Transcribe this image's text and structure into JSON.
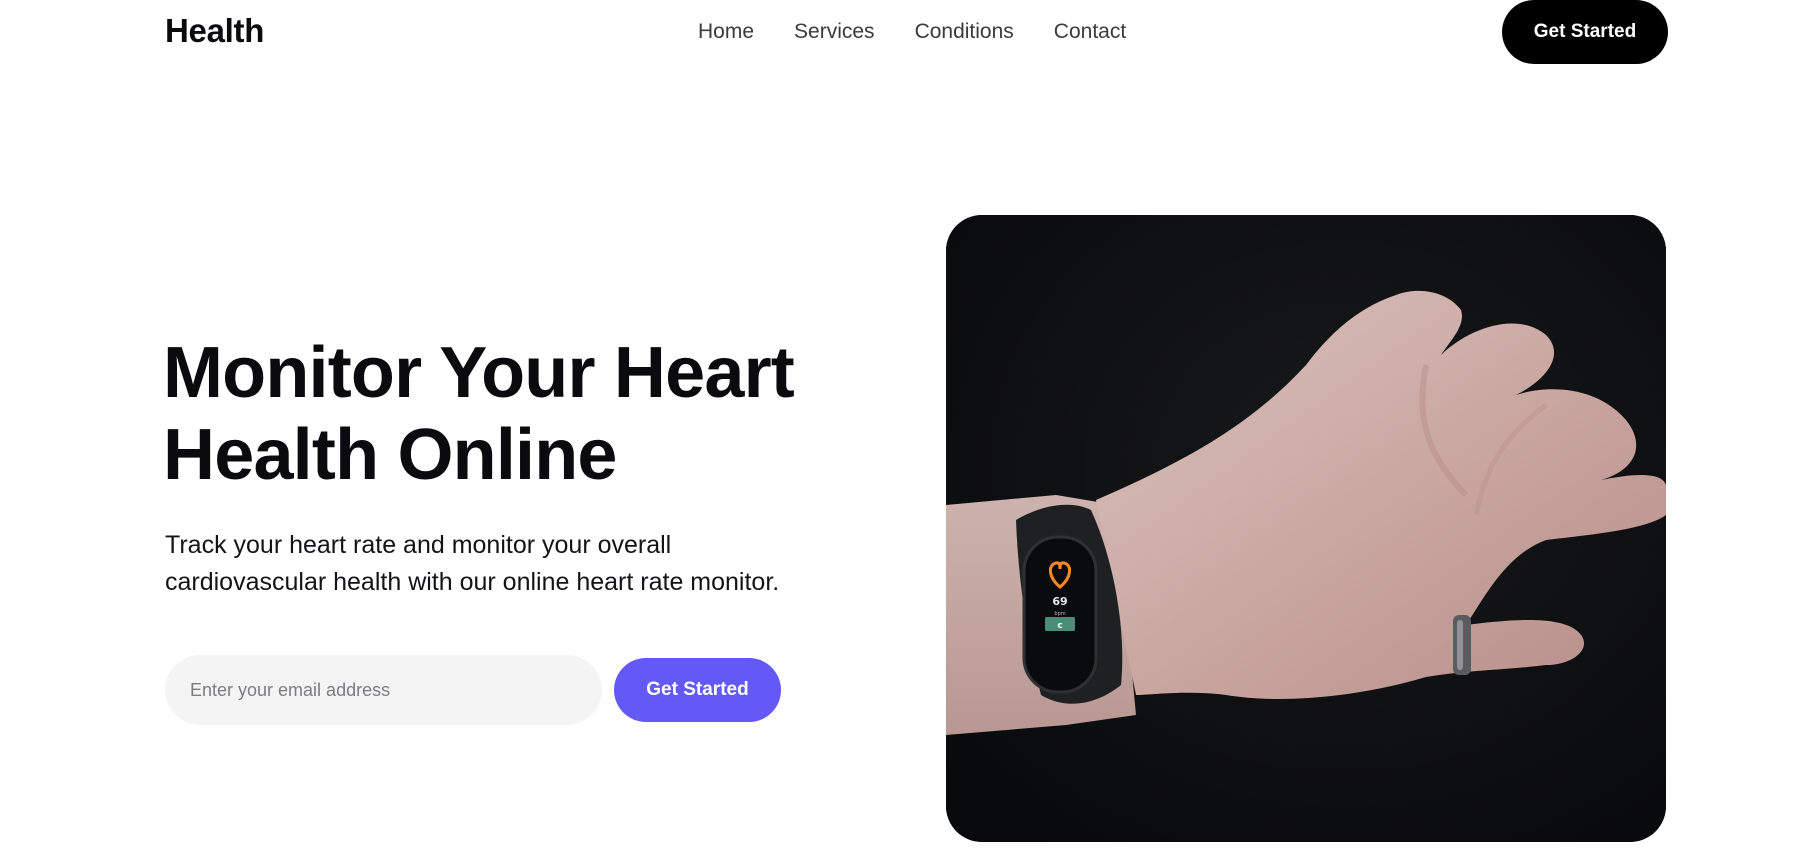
{
  "nav": {
    "logo": "Health",
    "links": [
      "Home",
      "Services",
      "Conditions",
      "Contact"
    ],
    "cta_label": "Get Started"
  },
  "hero": {
    "title_line1": "Monitor Your Heart",
    "title_line2": "Health Online",
    "description_line1": "Track your heart rate and monitor your overall",
    "description_line2": "cardiovascular health with our online heart rate monitor.",
    "email_placeholder": "Enter your email address",
    "signup_label": "Get Started"
  },
  "colors": {
    "primary_text": "#0b0b0f",
    "accent": "#6259f7",
    "nav_cta_bg": "#000000",
    "input_bg": "#f4f4f5"
  }
}
